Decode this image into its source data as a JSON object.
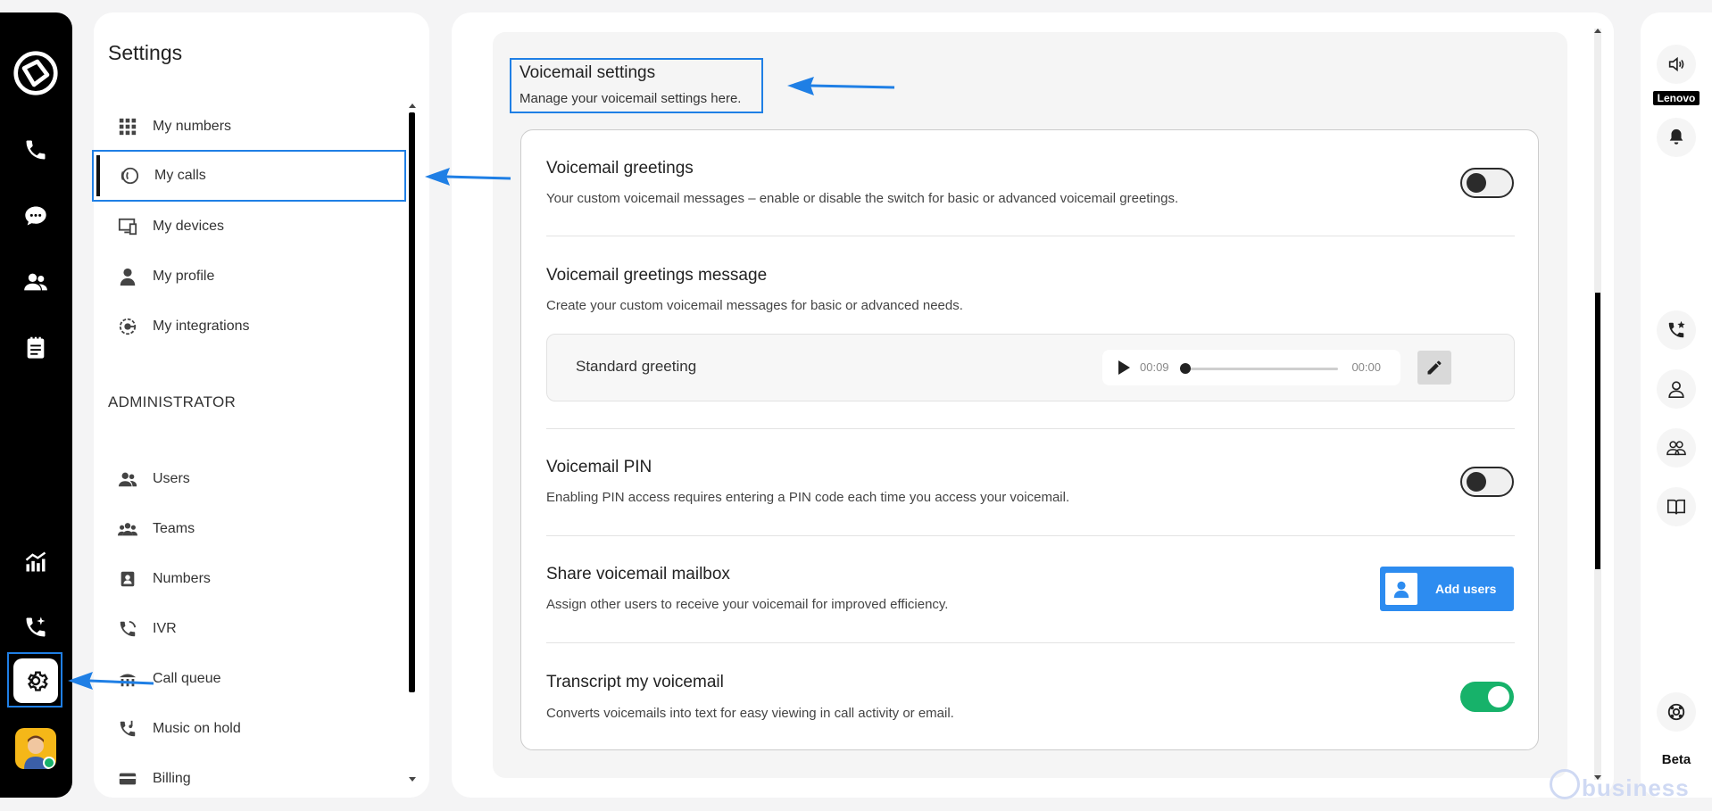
{
  "rail": {
    "items": [
      "logo-icon",
      "phone-icon",
      "chat-icon",
      "contacts-icon",
      "notes-icon",
      "analytics-icon",
      "call-sparkle-icon",
      "gear-icon",
      "avatar"
    ]
  },
  "settings": {
    "title": "Settings",
    "personal_items": [
      {
        "label": "My numbers",
        "icon": "grid-icon"
      },
      {
        "label": "My calls",
        "icon": "calls-icon",
        "active": true
      },
      {
        "label": "My devices",
        "icon": "devices-icon"
      },
      {
        "label": "My profile",
        "icon": "profile-icon"
      },
      {
        "label": "My integrations",
        "icon": "integrations-icon"
      }
    ],
    "admin_label": "ADMINISTRATOR",
    "admin_items": [
      {
        "label": "Users",
        "icon": "users-icon"
      },
      {
        "label": "Teams",
        "icon": "teams-icon"
      },
      {
        "label": "Numbers",
        "icon": "numbers-icon"
      },
      {
        "label": "IVR",
        "icon": "ivr-icon"
      },
      {
        "label": "Call queue",
        "icon": "call-queue-icon"
      },
      {
        "label": "Music on hold",
        "icon": "music-on-hold-icon"
      },
      {
        "label": "Billing",
        "icon": "billing-icon"
      }
    ]
  },
  "main": {
    "header_title": "Voicemail settings",
    "header_subtitle": "Manage your voicemail settings here.",
    "greetings": {
      "title": "Voicemail greetings",
      "desc": "Your custom voicemail messages – enable or disable the switch for basic or advanced voicemail greetings.",
      "enabled": false
    },
    "greetings_message": {
      "title": "Voicemail greetings message",
      "desc": "Create your custom voicemail messages for basic or advanced needs.",
      "greeting_label": "Standard greeting",
      "duration": "00:09",
      "position": "00:00"
    },
    "pin": {
      "title": "Voicemail PIN",
      "desc": "Enabling PIN access requires entering a PIN code each time you access your voicemail.",
      "enabled": false
    },
    "share": {
      "title": "Share voicemail mailbox",
      "desc": "Assign other users to receive your voicemail for improved efficiency.",
      "button": "Add users"
    },
    "transcript": {
      "title": "Transcript my voicemail",
      "desc": "Converts voicemails into text for easy viewing in call activity or email.",
      "enabled": true
    }
  },
  "right_rail": {
    "device_label": "Lenovo",
    "beta_label": "Beta"
  },
  "watermark": "business",
  "colors": {
    "accent": "#1f7fe5",
    "toggle_on": "#17b26a",
    "button": "#2d8cf0"
  }
}
